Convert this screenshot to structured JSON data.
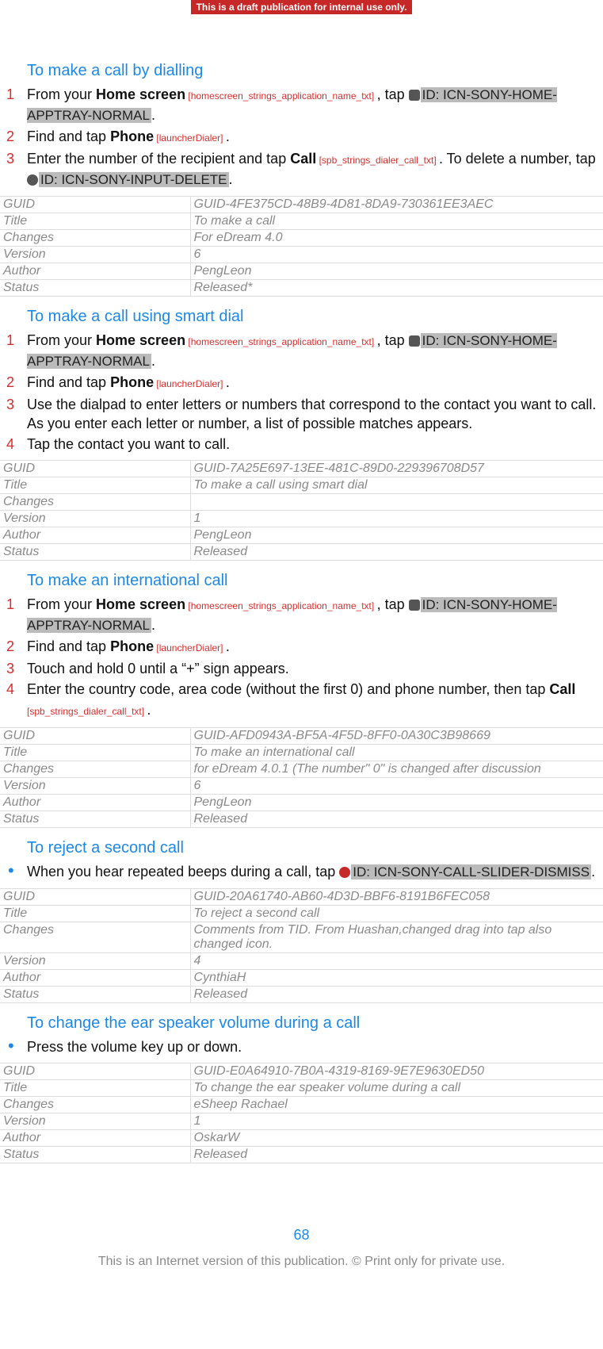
{
  "banner": "This is a draft publication for internal use only.",
  "page_number": "68",
  "footer": "This is an Internet version of this publication. © Print only for private use.",
  "strings": {
    "home_screen": "Home screen",
    "phone": "Phone",
    "call": "Call",
    "home_ref": "[homescreen_strings_application_name_txt]",
    "phone_ref": "[launcherDialer]",
    "call_ref": "[spb_strings_dialer_call_txt]",
    "icn_apptray": "ID: ICN-SONY-HOME-APPTRAY-NORMAL",
    "icn_delete": "ID: ICN-SONY-INPUT-DELETE",
    "icn_dismiss": "ID: ICN-SONY-CALL-SLIDER-DISMISS"
  },
  "sections": [
    {
      "title": "To make a call by dialling",
      "type": "ordered",
      "steps": [
        {
          "kind": "home_tap"
        },
        {
          "kind": "phone_tap"
        },
        {
          "kind": "dial_call_delete"
        }
      ],
      "meta": {
        "GUID": "GUID-4FE375CD-48B9-4D81-8DA9-730361EE3AEC",
        "Title": "To make a call",
        "Changes": "For eDream 4.0",
        "Version": "6",
        "Author": "PengLeon",
        "Status": "Released*"
      }
    },
    {
      "title": "To make a call using smart dial",
      "type": "ordered",
      "steps": [
        {
          "kind": "home_tap"
        },
        {
          "kind": "phone_tap"
        },
        {
          "kind": "text",
          "text": "Use the dialpad to enter letters or numbers that correspond to the contact you want to call. As you enter each letter or number, a list of possible matches appears."
        },
        {
          "kind": "text",
          "text": "Tap the contact you want to call."
        }
      ],
      "meta": {
        "GUID": "GUID-7A25E697-13EE-481C-89D0-229396708D57",
        "Title": "To make a call using smart dial",
        "Changes": "",
        "Version": "1",
        "Author": "PengLeon",
        "Status": "Released"
      }
    },
    {
      "title": "To make an international call",
      "type": "ordered",
      "steps": [
        {
          "kind": "home_tap"
        },
        {
          "kind": "phone_tap"
        },
        {
          "kind": "text",
          "text": "Touch and hold 0 until a “+” sign appears."
        },
        {
          "kind": "intl_call"
        }
      ],
      "meta": {
        "GUID": "GUID-AFD0943A-BF5A-4F5D-8FF0-0A30C3B98669",
        "Title": "To make an international call",
        "Changes": "for eDream 4.0.1 (The number\" 0\" is changed after discussion",
        "Version": "6",
        "Author": "PengLeon",
        "Status": "Released"
      }
    },
    {
      "title": "To reject a second call",
      "type": "bullet",
      "steps": [
        {
          "kind": "reject_call"
        }
      ],
      "meta": {
        "GUID": "GUID-20A61740-AB60-4D3D-BBF6-8191B6FEC058",
        "Title": "To reject a second call",
        "Changes": "Comments from TID. From Huashan,changed drag into tap also changed icon.",
        "Version": "4",
        "Author": "CynthiaH",
        "Status": "Released"
      }
    },
    {
      "title": "To change the ear speaker volume during a call",
      "type": "bullet",
      "steps": [
        {
          "kind": "text",
          "text": "Press the volume key up or down."
        }
      ],
      "meta": {
        "GUID": "GUID-E0A64910-7B0A-4319-8169-9E7E9630ED50",
        "Title": "To change the ear speaker volume during a call",
        "Changes": "eSheep Rachael",
        "Version": "1",
        "Author": "OskarW",
        "Status": "Released"
      }
    }
  ],
  "meta_labels": [
    "GUID",
    "Title",
    "Changes",
    "Version",
    "Author",
    "Status"
  ]
}
